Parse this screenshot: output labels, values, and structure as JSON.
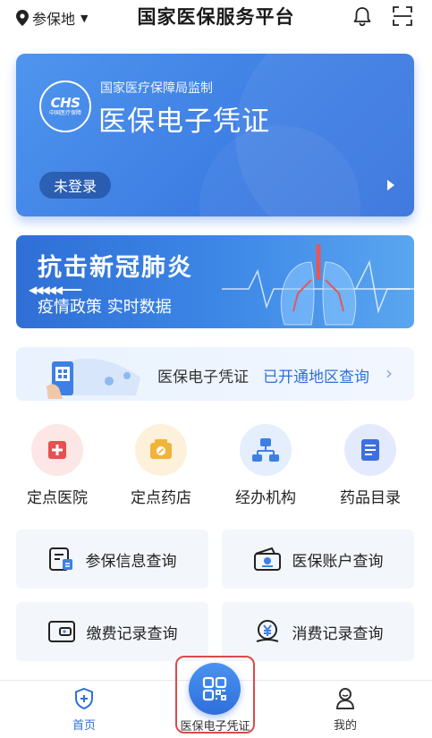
{
  "header": {
    "location_label": "参保地",
    "title": "国家医保服务平台"
  },
  "card": {
    "logo_text": "CHS",
    "logo_subtext": "中国医疗保障",
    "subtitle": "国家医疗保障局监制",
    "title": "医保电子凭证",
    "login_status": "未登录"
  },
  "covid_banner": {
    "headline": "抗击新冠肺炎",
    "subline": "疫情政策  实时数据"
  },
  "info_strip": {
    "text": "医保电子凭证",
    "link": "已开通地区查询"
  },
  "quick_entries": [
    {
      "label": "定点医院",
      "icon": "hospital-icon"
    },
    {
      "label": "定点药店",
      "icon": "pharmacy-icon"
    },
    {
      "label": "经办机构",
      "icon": "organization-icon"
    },
    {
      "label": "药品目录",
      "icon": "catalog-icon"
    }
  ],
  "query_tiles": [
    {
      "label": "参保信息查询",
      "icon": "insurance-info-icon"
    },
    {
      "label": "医保账户查询",
      "icon": "account-icon"
    },
    {
      "label": "缴费记录查询",
      "icon": "wallet-icon"
    },
    {
      "label": "消费记录查询",
      "icon": "consumption-icon"
    }
  ],
  "bottom_nav": {
    "home": "首页",
    "voucher": "医保电子凭证",
    "me": "我的"
  },
  "colors": {
    "primary": "#3e7fe4",
    "link": "#2f6fdb",
    "highlight_border": "#d94b4b"
  }
}
